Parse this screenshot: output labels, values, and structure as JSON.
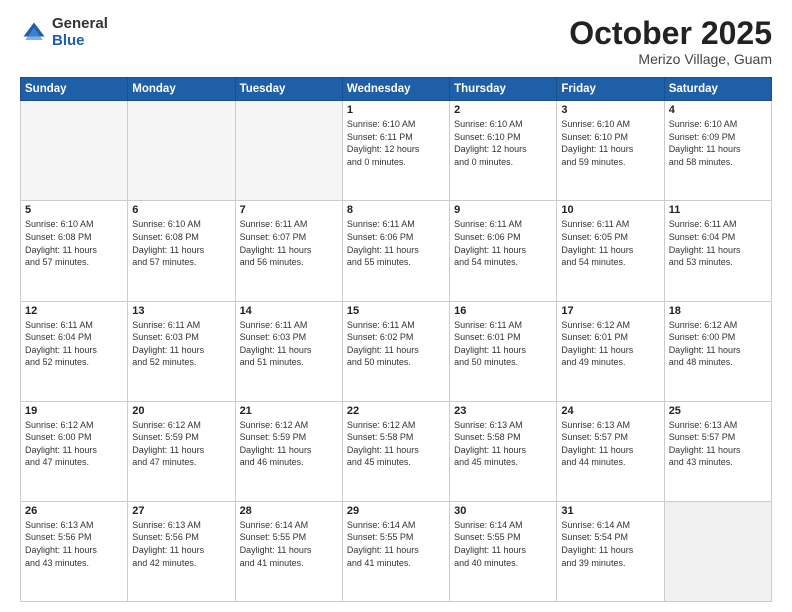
{
  "header": {
    "logo_general": "General",
    "logo_blue": "Blue",
    "month": "October 2025",
    "location": "Merizo Village, Guam"
  },
  "weekdays": [
    "Sunday",
    "Monday",
    "Tuesday",
    "Wednesday",
    "Thursday",
    "Friday",
    "Saturday"
  ],
  "weeks": [
    [
      {
        "day": "",
        "info": ""
      },
      {
        "day": "",
        "info": ""
      },
      {
        "day": "",
        "info": ""
      },
      {
        "day": "1",
        "info": "Sunrise: 6:10 AM\nSunset: 6:11 PM\nDaylight: 12 hours\nand 0 minutes."
      },
      {
        "day": "2",
        "info": "Sunrise: 6:10 AM\nSunset: 6:10 PM\nDaylight: 12 hours\nand 0 minutes."
      },
      {
        "day": "3",
        "info": "Sunrise: 6:10 AM\nSunset: 6:10 PM\nDaylight: 11 hours\nand 59 minutes."
      },
      {
        "day": "4",
        "info": "Sunrise: 6:10 AM\nSunset: 6:09 PM\nDaylight: 11 hours\nand 58 minutes."
      }
    ],
    [
      {
        "day": "5",
        "info": "Sunrise: 6:10 AM\nSunset: 6:08 PM\nDaylight: 11 hours\nand 57 minutes."
      },
      {
        "day": "6",
        "info": "Sunrise: 6:10 AM\nSunset: 6:08 PM\nDaylight: 11 hours\nand 57 minutes."
      },
      {
        "day": "7",
        "info": "Sunrise: 6:11 AM\nSunset: 6:07 PM\nDaylight: 11 hours\nand 56 minutes."
      },
      {
        "day": "8",
        "info": "Sunrise: 6:11 AM\nSunset: 6:06 PM\nDaylight: 11 hours\nand 55 minutes."
      },
      {
        "day": "9",
        "info": "Sunrise: 6:11 AM\nSunset: 6:06 PM\nDaylight: 11 hours\nand 54 minutes."
      },
      {
        "day": "10",
        "info": "Sunrise: 6:11 AM\nSunset: 6:05 PM\nDaylight: 11 hours\nand 54 minutes."
      },
      {
        "day": "11",
        "info": "Sunrise: 6:11 AM\nSunset: 6:04 PM\nDaylight: 11 hours\nand 53 minutes."
      }
    ],
    [
      {
        "day": "12",
        "info": "Sunrise: 6:11 AM\nSunset: 6:04 PM\nDaylight: 11 hours\nand 52 minutes."
      },
      {
        "day": "13",
        "info": "Sunrise: 6:11 AM\nSunset: 6:03 PM\nDaylight: 11 hours\nand 52 minutes."
      },
      {
        "day": "14",
        "info": "Sunrise: 6:11 AM\nSunset: 6:03 PM\nDaylight: 11 hours\nand 51 minutes."
      },
      {
        "day": "15",
        "info": "Sunrise: 6:11 AM\nSunset: 6:02 PM\nDaylight: 11 hours\nand 50 minutes."
      },
      {
        "day": "16",
        "info": "Sunrise: 6:11 AM\nSunset: 6:01 PM\nDaylight: 11 hours\nand 50 minutes."
      },
      {
        "day": "17",
        "info": "Sunrise: 6:12 AM\nSunset: 6:01 PM\nDaylight: 11 hours\nand 49 minutes."
      },
      {
        "day": "18",
        "info": "Sunrise: 6:12 AM\nSunset: 6:00 PM\nDaylight: 11 hours\nand 48 minutes."
      }
    ],
    [
      {
        "day": "19",
        "info": "Sunrise: 6:12 AM\nSunset: 6:00 PM\nDaylight: 11 hours\nand 47 minutes."
      },
      {
        "day": "20",
        "info": "Sunrise: 6:12 AM\nSunset: 5:59 PM\nDaylight: 11 hours\nand 47 minutes."
      },
      {
        "day": "21",
        "info": "Sunrise: 6:12 AM\nSunset: 5:59 PM\nDaylight: 11 hours\nand 46 minutes."
      },
      {
        "day": "22",
        "info": "Sunrise: 6:12 AM\nSunset: 5:58 PM\nDaylight: 11 hours\nand 45 minutes."
      },
      {
        "day": "23",
        "info": "Sunrise: 6:13 AM\nSunset: 5:58 PM\nDaylight: 11 hours\nand 45 minutes."
      },
      {
        "day": "24",
        "info": "Sunrise: 6:13 AM\nSunset: 5:57 PM\nDaylight: 11 hours\nand 44 minutes."
      },
      {
        "day": "25",
        "info": "Sunrise: 6:13 AM\nSunset: 5:57 PM\nDaylight: 11 hours\nand 43 minutes."
      }
    ],
    [
      {
        "day": "26",
        "info": "Sunrise: 6:13 AM\nSunset: 5:56 PM\nDaylight: 11 hours\nand 43 minutes."
      },
      {
        "day": "27",
        "info": "Sunrise: 6:13 AM\nSunset: 5:56 PM\nDaylight: 11 hours\nand 42 minutes."
      },
      {
        "day": "28",
        "info": "Sunrise: 6:14 AM\nSunset: 5:55 PM\nDaylight: 11 hours\nand 41 minutes."
      },
      {
        "day": "29",
        "info": "Sunrise: 6:14 AM\nSunset: 5:55 PM\nDaylight: 11 hours\nand 41 minutes."
      },
      {
        "day": "30",
        "info": "Sunrise: 6:14 AM\nSunset: 5:55 PM\nDaylight: 11 hours\nand 40 minutes."
      },
      {
        "day": "31",
        "info": "Sunrise: 6:14 AM\nSunset: 5:54 PM\nDaylight: 11 hours\nand 39 minutes."
      },
      {
        "day": "",
        "info": ""
      }
    ]
  ]
}
